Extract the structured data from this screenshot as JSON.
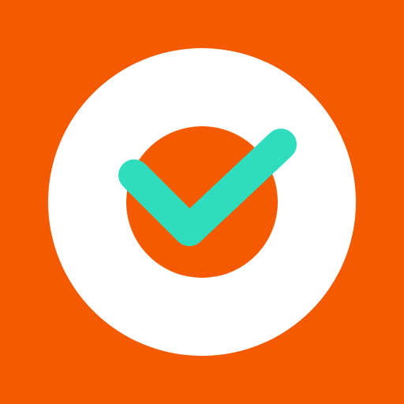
{
  "icon": {
    "name": "check-circle-app-icon",
    "colors": {
      "background": "#F55A00",
      "ring": "#FFFFFF",
      "inner_circle": "#F55A00",
      "checkmark": "#2EDDBE"
    }
  }
}
